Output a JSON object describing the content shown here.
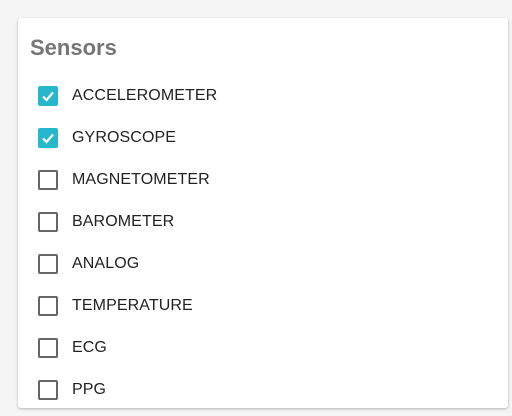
{
  "panel": {
    "title": "Sensors",
    "accent_color": "#26b7cc",
    "sensors": [
      {
        "label": "ACCELEROMETER",
        "checked": true
      },
      {
        "label": "GYROSCOPE",
        "checked": true
      },
      {
        "label": "MAGNETOMETER",
        "checked": false
      },
      {
        "label": "BAROMETER",
        "checked": false
      },
      {
        "label": "ANALOG",
        "checked": false
      },
      {
        "label": "TEMPERATURE",
        "checked": false
      },
      {
        "label": "ECG",
        "checked": false
      },
      {
        "label": "PPG",
        "checked": false
      }
    ]
  }
}
